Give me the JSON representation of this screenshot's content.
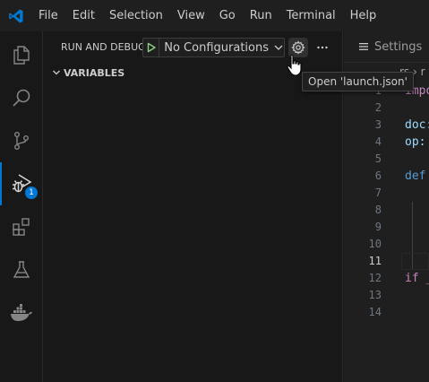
{
  "menu": [
    "File",
    "Edit",
    "Selection",
    "View",
    "Go",
    "Run",
    "Terminal",
    "Help"
  ],
  "activity_bar": {
    "items": [
      {
        "name": "explorer-icon"
      },
      {
        "name": "search-icon"
      },
      {
        "name": "source-control-icon"
      },
      {
        "name": "run-debug-icon",
        "active": true,
        "badge": "1"
      },
      {
        "name": "extensions-icon"
      },
      {
        "name": "testing-icon"
      },
      {
        "name": "docker-icon"
      }
    ]
  },
  "sidebar": {
    "title": "RUN AND DEBUG",
    "configuration": "No Configurations",
    "section": "VARIABLES"
  },
  "tooltip": "Open 'launch.json'",
  "editor": {
    "tab_label": "Settings",
    "breadcrumb": "rs › r",
    "line_numbers": [
      "1",
      "2",
      "3",
      "4",
      "5",
      "6",
      "7",
      "8",
      "9",
      "10",
      "11",
      "12",
      "13",
      "14"
    ],
    "active_line": "11",
    "code": {
      "l1": "impo",
      "l3": "doc:",
      "l4": "op: ",
      "l6": "def ",
      "l12": "if _"
    }
  },
  "colors": {
    "accent": "#0078d4",
    "play_green": "#89d185",
    "keyword_blue": "#569cd6",
    "keyword_purple": "#c586c0",
    "variable": "#9cdcfe"
  }
}
